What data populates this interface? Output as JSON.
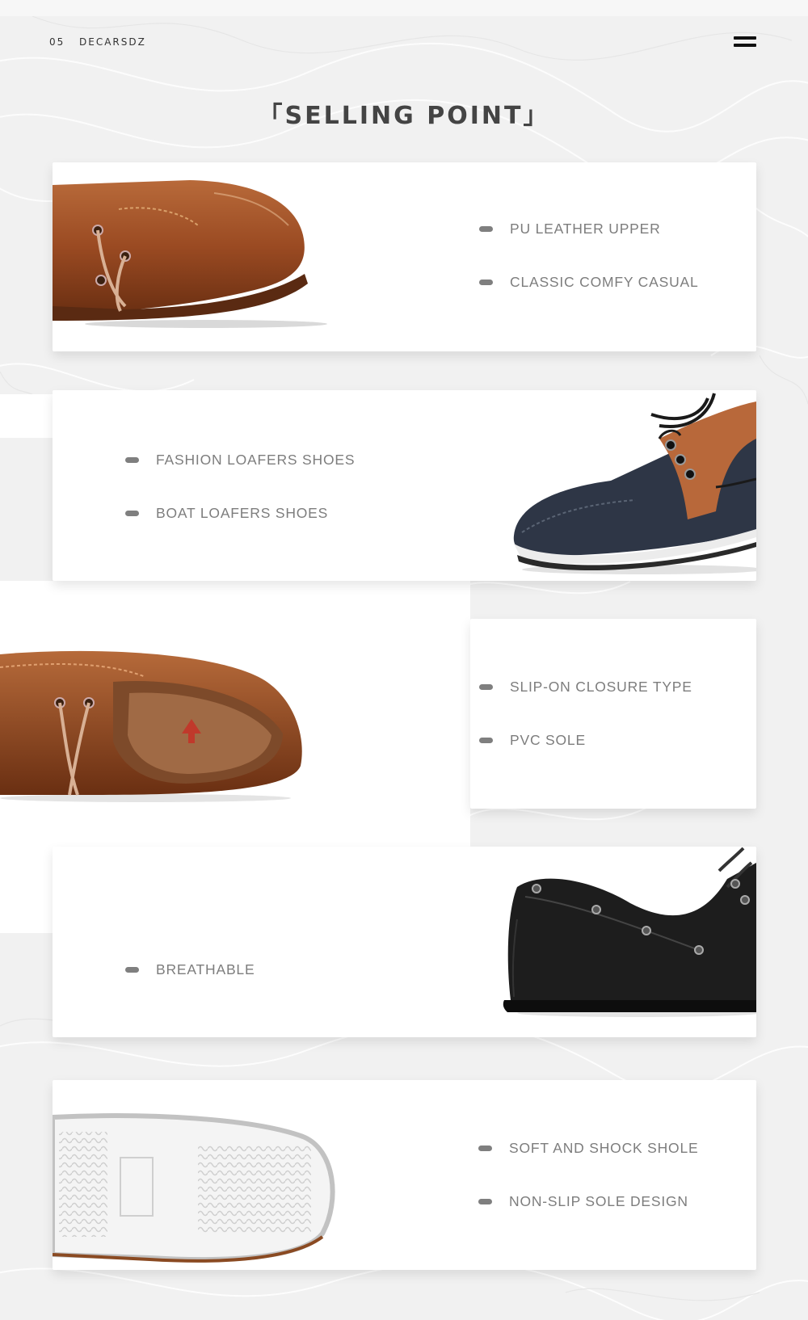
{
  "header": {
    "page_number": "05",
    "brand": "DECARSDZ",
    "menu_icon": "hamburger-menu-icon"
  },
  "title": "「SELLING POINT」",
  "sections": [
    {
      "features": [
        "PU LEATHER UPPER",
        "CLASSIC COMFY CASUAL"
      ],
      "image": "brown-boat-shoe-toe"
    },
    {
      "features": [
        "FASHION LOAFERS SHOES",
        "BOAT LOAFERS SHOES"
      ],
      "image": "navy-brown-boat-shoe"
    },
    {
      "features": [
        "SLIP-ON CLOSURE TYPE",
        "PVC SOLE"
      ],
      "image": "brown-boat-shoe-insole"
    },
    {
      "features": [
        "BREATHABLE"
      ],
      "image": "black-boat-shoe"
    },
    {
      "features": [
        "SOFT AND SHOCK SHOLE",
        "NON-SLIP SOLE DESIGN"
      ],
      "image": "white-sole"
    }
  ],
  "colors": {
    "background": "#f1f1f1",
    "card": "#ffffff",
    "text": "#7d7d7d",
    "title": "#444444",
    "brown_leather": "#9a4a22",
    "navy_leather": "#2e3646",
    "black_leather": "#1c1c1c"
  }
}
